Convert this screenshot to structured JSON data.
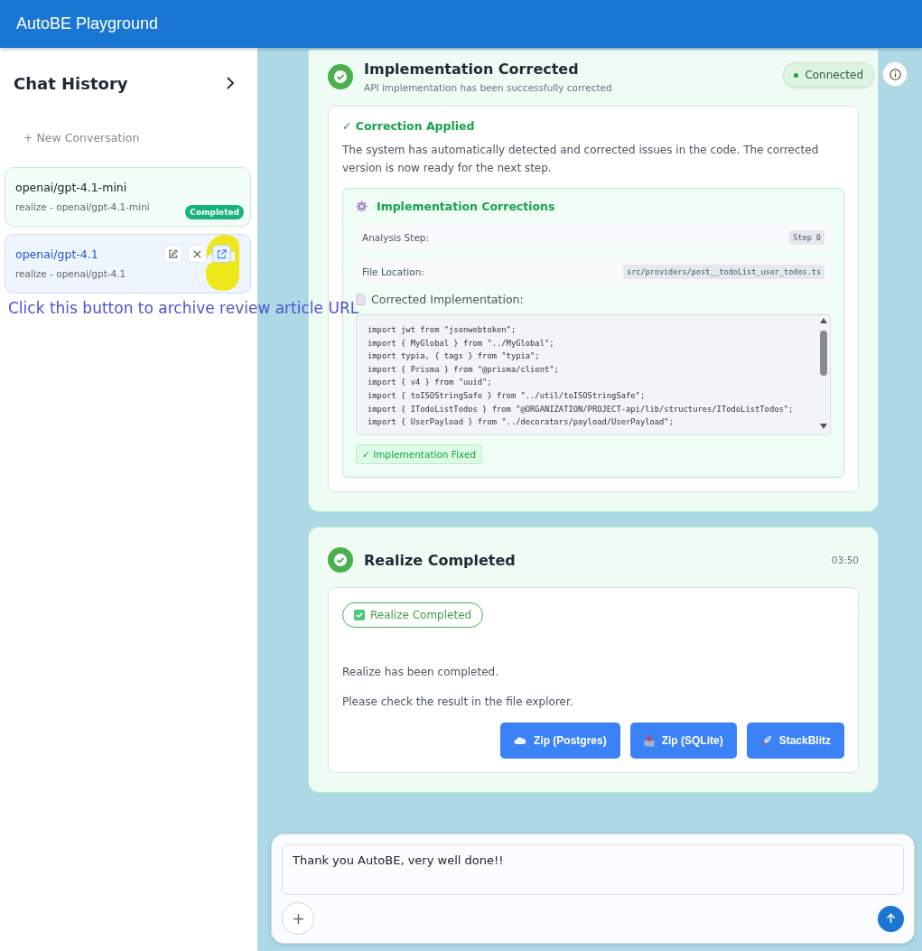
{
  "app": {
    "title": "AutoBE Playground"
  },
  "sidebar": {
    "title": "Chat History",
    "new_conversation": "+ New Conversation",
    "sessions": [
      {
        "title": "openai/gpt-4.1-mini",
        "subtitle": "realize - openai/gpt-4.1-mini",
        "badge": "Completed",
        "selected": false,
        "highlighted": false
      },
      {
        "title": "openai/gpt-4.1",
        "subtitle": "realize - openai/gpt-4.1",
        "selected": true,
        "highlighted": true
      }
    ],
    "annotation": "Click this button to archive review article URL"
  },
  "connection": {
    "label": "Connected",
    "connected": true
  },
  "events": [
    {
      "kind": "correction",
      "title": "Implementation Corrected",
      "subtitle": "API implementation has been successfully corrected",
      "section_title": "✓ Correction Applied",
      "description": "The system has automatically detected and corrected issues in the code. The corrected version is now ready for the next step.",
      "panel_title": "Implementation Corrections",
      "fields": [
        {
          "label": "Analysis Step:",
          "value": "Step 0"
        },
        {
          "label": "File Location:",
          "value": "src/providers/post__todoList_user_todos.ts"
        }
      ],
      "code_title": "Corrected Implementation:",
      "code": [
        "import jwt from \"jsonwebtoken\";",
        "import { MyGlobal } from \"../MyGlobal\";",
        "import typia, { tags } from \"typia\";",
        "import { Prisma } from \"@prisma/client\";",
        "import { v4 } from \"uuid\";",
        "import { toISOStringSafe } from \"../util/toISOStringSafe\";",
        "import { ITodoListTodos } from \"@ORGANIZATION/PROJECT-api/lib/structures/ITodoListTodos\";",
        "import { UserPayload } from \"../decorators/payload/UserPayload\";"
      ],
      "status": "✓ Implementation Fixed"
    },
    {
      "kind": "completion",
      "title": "Realize Completed",
      "time": "03:50",
      "badge": "Realize Completed",
      "messages": [
        "Realize has been completed.",
        "Please check the result in the file explorer."
      ],
      "buttons": [
        {
          "label": "Zip (Postgres)",
          "kind": "cloud"
        },
        {
          "label": "Zip (SQLite)",
          "kind": "tray"
        },
        {
          "label": "StackBlitz",
          "kind": "rocket"
        }
      ]
    }
  ],
  "input": {
    "value": "Thank you AutoBE, very well done!!"
  }
}
